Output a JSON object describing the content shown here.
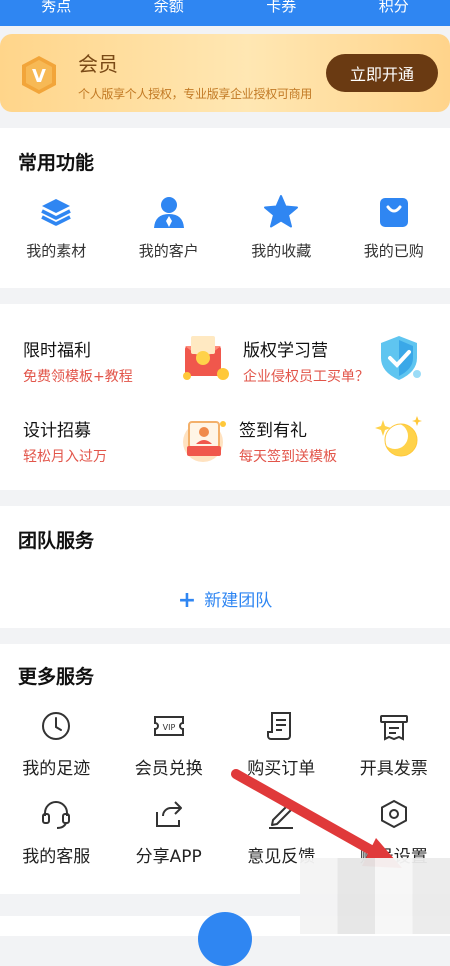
{
  "top_stats": [
    "秀点",
    "余额",
    "卡券",
    "积分"
  ],
  "member": {
    "badge": "V",
    "title": "会员",
    "subtitle": "个人版享个人授权，专业版享企业授权可商用",
    "button": "立即开通"
  },
  "common": {
    "title": "常用功能",
    "items": [
      {
        "label": "我的素材",
        "icon": "layers-icon"
      },
      {
        "label": "我的客户",
        "icon": "user-icon"
      },
      {
        "label": "我的收藏",
        "icon": "star-icon"
      },
      {
        "label": "我的已购",
        "icon": "shopping-bag-icon"
      }
    ]
  },
  "promos": [
    {
      "title": "限时福利",
      "subtitle": "免费领模板+教程",
      "icon": "gift-envelope-icon"
    },
    {
      "title": "版权学习营",
      "subtitle": "企业侵权员工买单？",
      "icon": "shield-icon"
    },
    {
      "title": "设计招募",
      "subtitle": "轻松月入过万",
      "icon": "portrait-card-icon"
    },
    {
      "title": "签到有礼",
      "subtitle": "每天签到送模板",
      "icon": "moon-sparkle-icon"
    }
  ],
  "team": {
    "title": "团队服务",
    "new_team": "新建团队"
  },
  "more": {
    "title": "更多服务",
    "row1": [
      {
        "label": "我的足迹",
        "icon": "clock-icon"
      },
      {
        "label": "会员兑换",
        "icon": "vip-ticket-icon"
      },
      {
        "label": "购买订单",
        "icon": "order-list-icon"
      },
      {
        "label": "开具发票",
        "icon": "invoice-icon"
      }
    ],
    "row2": [
      {
        "label": "我的客服",
        "icon": "headset-icon"
      },
      {
        "label": "分享APP",
        "icon": "share-icon"
      },
      {
        "label": "意见反馈",
        "icon": "edit-pen-icon"
      },
      {
        "label": "账号设置",
        "icon": "settings-hexagon-icon"
      }
    ]
  },
  "colors": {
    "primary": "#2f86f2",
    "member_dark": "#6a3a12",
    "promo_red": "#e2554a",
    "arrow": "#e0393a"
  }
}
